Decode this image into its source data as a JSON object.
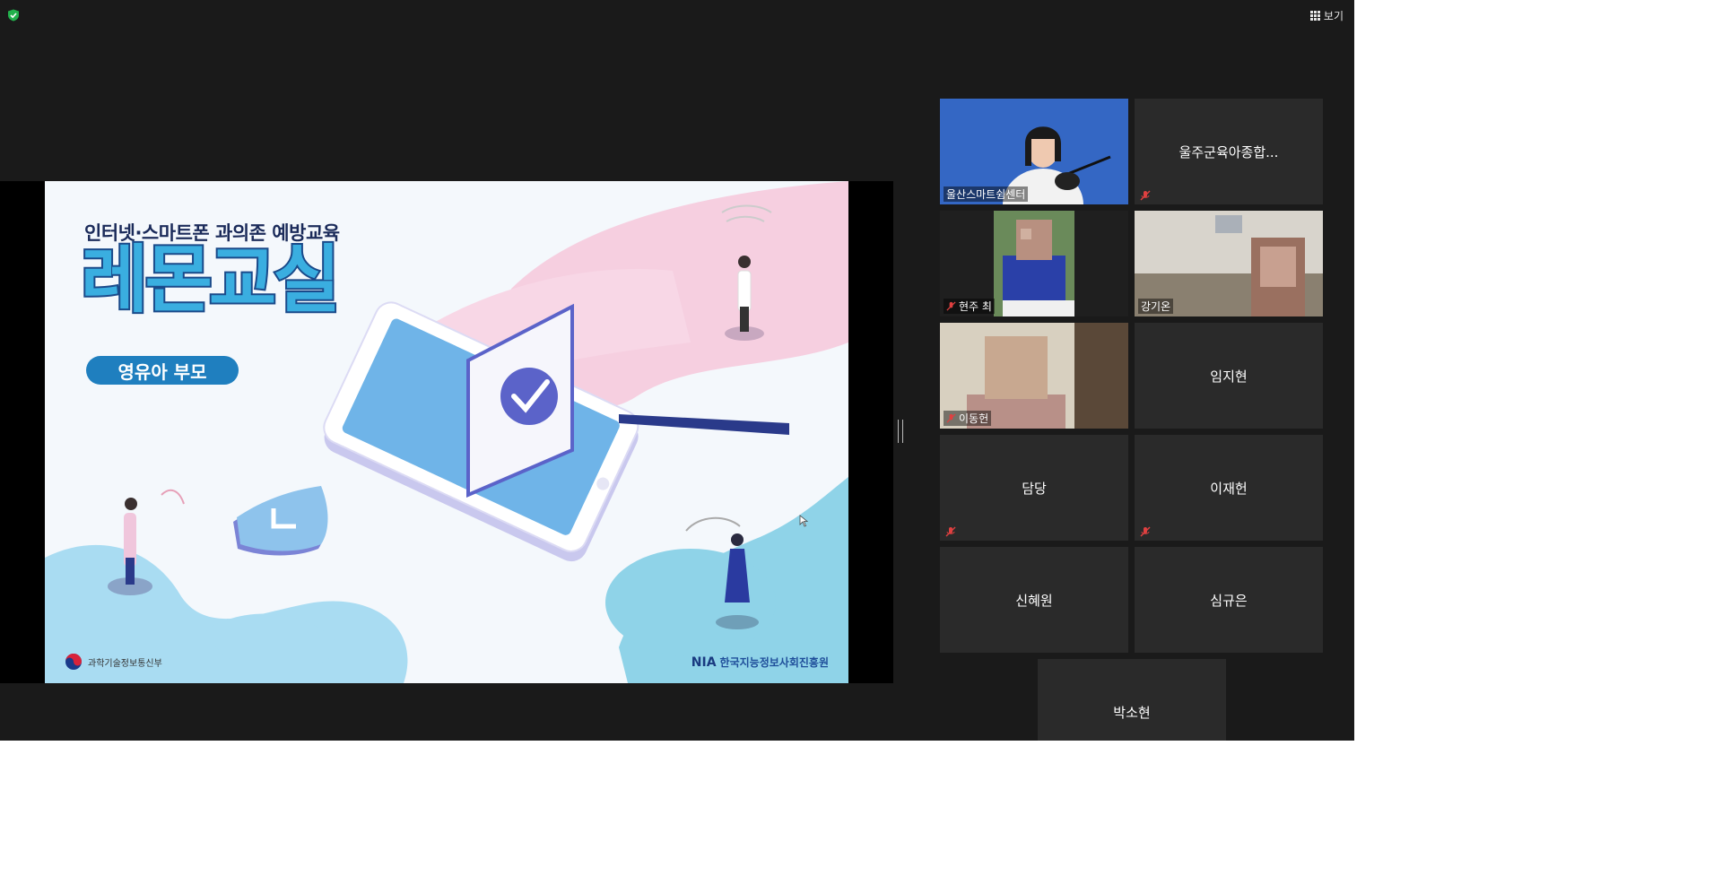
{
  "toolbar": {
    "view_label": "보기"
  },
  "slide": {
    "subtitle": "인터넷·스마트폰 과의존 예방교육",
    "title": "레몬교실",
    "pill": "영유아 부모",
    "ministry": "과학기술정보통신부",
    "org_abbr": "NIA",
    "org_name": "한국지능정보사회진흥원"
  },
  "participants": [
    {
      "name": "울산스마트쉼센터",
      "video": true,
      "muted": false,
      "active": true
    },
    {
      "name": "울주군육아종합...",
      "video": false,
      "muted": true
    },
    {
      "name": "현주 최",
      "video": true,
      "muted": true
    },
    {
      "name": "강기온",
      "video": true,
      "muted": false
    },
    {
      "name": "이동헌",
      "video": true,
      "muted": true
    },
    {
      "name": "임지현",
      "video": false,
      "muted": false
    },
    {
      "name": "담당",
      "video": false,
      "muted": true
    },
    {
      "name": "이재헌",
      "video": false,
      "muted": true
    },
    {
      "name": "신혜원",
      "video": false,
      "muted": false
    },
    {
      "name": "심규은",
      "video": false,
      "muted": false
    },
    {
      "name": "박소현",
      "video": false,
      "muted": false
    }
  ],
  "colors": {
    "app_bg": "#1a1a1a",
    "tile_bg": "#2a2a2a",
    "active_outline": "#e9e35a",
    "mute_red": "#e04040"
  }
}
